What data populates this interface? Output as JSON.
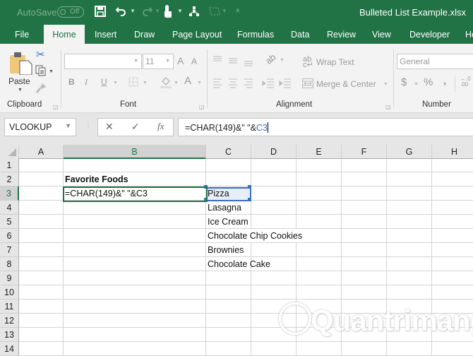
{
  "titlebar": {
    "autosave_label": "AutoSave",
    "autosave_state": "Off",
    "filename": "Bulleted List Example.xlsx",
    "qat_icons": [
      "save-icon",
      "undo-icon",
      "redo-icon",
      "touch-mode-icon",
      "org-chart-icon",
      "shape-icon",
      "customize-qat-icon"
    ]
  },
  "tabs": [
    {
      "label": "File",
      "active": false
    },
    {
      "label": "Home",
      "active": true
    },
    {
      "label": "Insert",
      "active": false
    },
    {
      "label": "Draw",
      "active": false
    },
    {
      "label": "Page Layout",
      "active": false
    },
    {
      "label": "Formulas",
      "active": false
    },
    {
      "label": "Data",
      "active": false
    },
    {
      "label": "Review",
      "active": false
    },
    {
      "label": "View",
      "active": false
    },
    {
      "label": "Developer",
      "active": false
    },
    {
      "label": "He",
      "active": false
    }
  ],
  "ribbon": {
    "clipboard": {
      "label": "Clipboard",
      "paste_label": "Paste"
    },
    "font": {
      "label": "Font",
      "font_name": "",
      "font_size": "11",
      "bold": "B",
      "italic": "I",
      "underline": "U",
      "font_color": "A",
      "grow": "A",
      "shrink": "A"
    },
    "alignment": {
      "label": "Alignment",
      "wrap_text": "Wrap Text",
      "merge_center": "Merge & Center"
    },
    "number": {
      "label": "Number",
      "format": "General",
      "currency": "$",
      "percent": "%",
      "comma": ","
    }
  },
  "formula_bar": {
    "name_box": "VLOOKUP",
    "formula_prefix": "=CHAR(149)&\" \"&",
    "formula_ref": "C3",
    "cancel": "✕",
    "enter": "✓",
    "fx": "fx"
  },
  "sheet": {
    "columns": [
      "A",
      "B",
      "C",
      "D",
      "E",
      "F",
      "G",
      "H"
    ],
    "selected_column": "B",
    "rows": [
      "1",
      "2",
      "3",
      "4",
      "5",
      "6",
      "7",
      "8",
      "9",
      "10",
      "11",
      "12",
      "13",
      "14"
    ],
    "selected_row": "3",
    "cells": {
      "B2": "Favorite Foods",
      "B3": "=CHAR(149)&\" \"&C3",
      "C3": "Pizza",
      "C4": "Lasagna",
      "C5": "Ice Cream",
      "C6": "Chocolate Chip Cookies",
      "C7": "Brownies",
      "C8": "Chocolate Cake"
    },
    "active_cell": "B3",
    "referenced_cell": "C3"
  },
  "watermark": "Quantrimang",
  "colors": {
    "excel_green": "#217346",
    "ref_blue": "#3a6fc4"
  }
}
